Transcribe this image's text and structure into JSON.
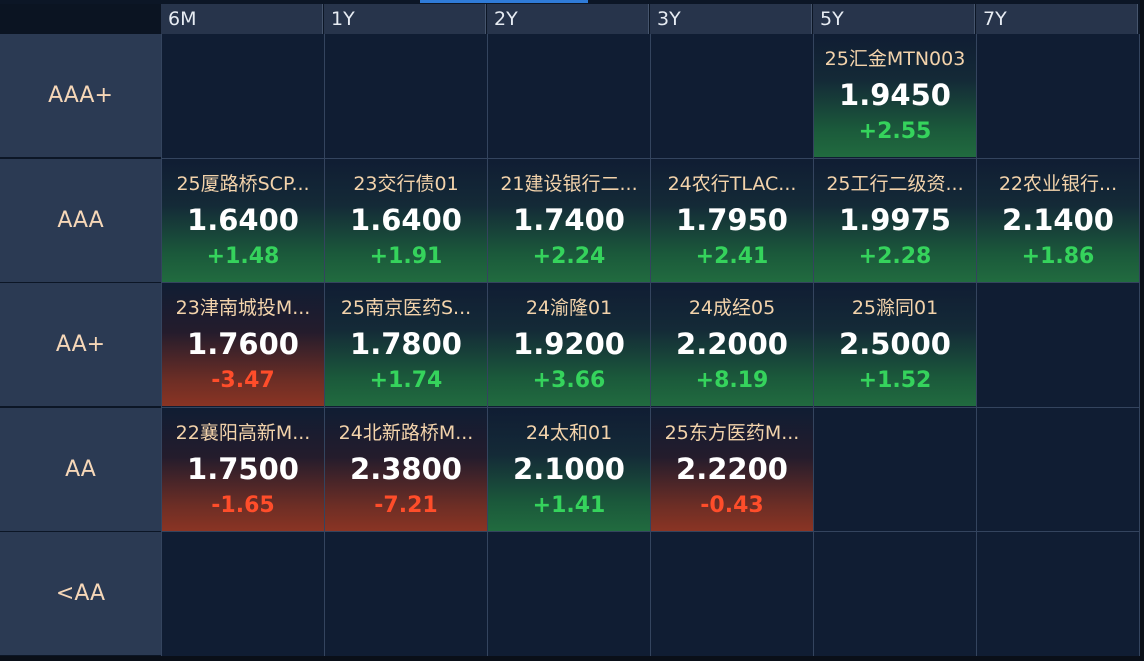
{
  "columns": [
    "6M",
    "1Y",
    "2Y",
    "3Y",
    "5Y",
    "7Y"
  ],
  "rows": [
    "AAA+",
    "AAA",
    "AA+",
    "AA",
    "<AA"
  ],
  "colors": {
    "up": "#35d35c",
    "down": "#ff4d2a",
    "name": "#f3d3ab",
    "header_bg": "#27344b",
    "row_label_bg": "#2b3a53",
    "grid_bg": "#101d33"
  },
  "cells": [
    {
      "row": 0,
      "col": 4,
      "name": "25汇金MTN003",
      "yield": "1.9450",
      "change": "+2.55",
      "dir": "up"
    },
    {
      "row": 1,
      "col": 0,
      "name": "25厦路桥SCP...",
      "yield": "1.6400",
      "change": "+1.48",
      "dir": "up"
    },
    {
      "row": 1,
      "col": 1,
      "name": "23交行债01",
      "yield": "1.6400",
      "change": "+1.91",
      "dir": "up"
    },
    {
      "row": 1,
      "col": 2,
      "name": "21建设银行二...",
      "yield": "1.7400",
      "change": "+2.24",
      "dir": "up"
    },
    {
      "row": 1,
      "col": 3,
      "name": "24农行TLAC...",
      "yield": "1.7950",
      "change": "+2.41",
      "dir": "up"
    },
    {
      "row": 1,
      "col": 4,
      "name": "25工行二级资...",
      "yield": "1.9975",
      "change": "+2.28",
      "dir": "up"
    },
    {
      "row": 1,
      "col": 5,
      "name": "22农业银行...",
      "yield": "2.1400",
      "change": "+1.86",
      "dir": "up"
    },
    {
      "row": 2,
      "col": 0,
      "name": "23津南城投M...",
      "yield": "1.7600",
      "change": "-3.47",
      "dir": "down"
    },
    {
      "row": 2,
      "col": 1,
      "name": "25南京医药S...",
      "yield": "1.7800",
      "change": "+1.74",
      "dir": "up"
    },
    {
      "row": 2,
      "col": 2,
      "name": "24渝隆01",
      "yield": "1.9200",
      "change": "+3.66",
      "dir": "up"
    },
    {
      "row": 2,
      "col": 3,
      "name": "24成经05",
      "yield": "2.2000",
      "change": "+8.19",
      "dir": "up"
    },
    {
      "row": 2,
      "col": 4,
      "name": "25滁同01",
      "yield": "2.5000",
      "change": "+1.52",
      "dir": "up"
    },
    {
      "row": 3,
      "col": 0,
      "name": "22襄阳高新M...",
      "yield": "1.7500",
      "change": "-1.65",
      "dir": "down"
    },
    {
      "row": 3,
      "col": 1,
      "name": "24北新路桥M...",
      "yield": "2.3800",
      "change": "-7.21",
      "dir": "down"
    },
    {
      "row": 3,
      "col": 2,
      "name": "24太和01",
      "yield": "2.1000",
      "change": "+1.41",
      "dir": "up"
    },
    {
      "row": 3,
      "col": 3,
      "name": "25东方医药M...",
      "yield": "2.2200",
      "change": "-0.43",
      "dir": "down"
    }
  ]
}
